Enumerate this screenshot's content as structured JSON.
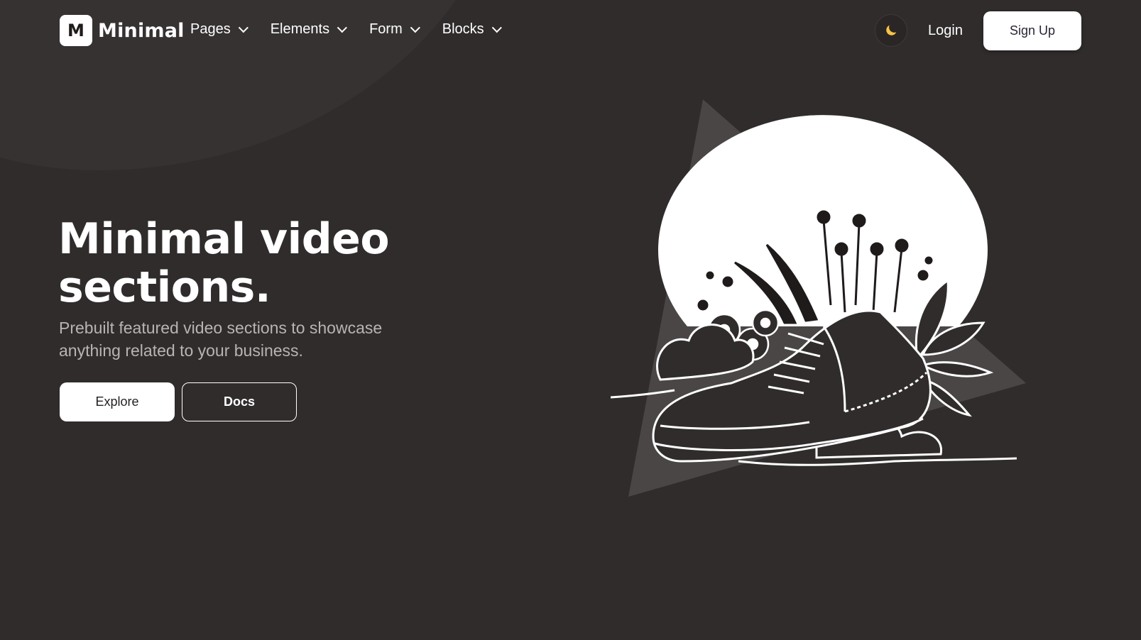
{
  "brand": {
    "logo_letter": "M",
    "name": "Minimal"
  },
  "nav": {
    "items": [
      {
        "label": "Pages"
      },
      {
        "label": "Elements"
      },
      {
        "label": "Form"
      },
      {
        "label": "Blocks"
      }
    ],
    "theme_icon": "moon-icon",
    "login_label": "Login",
    "signup_label": "Sign Up"
  },
  "hero": {
    "title": "Minimal video sections.",
    "subtitle": "Prebuilt featured video sections to showcase anything related to your business.",
    "explore_label": "Explore",
    "docs_label": "Docs"
  },
  "colors": {
    "background": "#302c2c",
    "accent_moon": "#f6c544",
    "button_bg": "#ffffff",
    "triangle": "#4a4646"
  }
}
